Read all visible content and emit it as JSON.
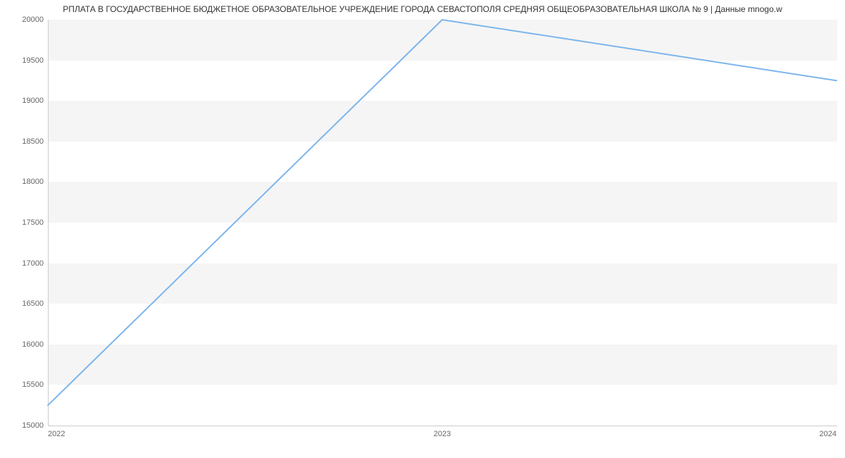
{
  "chart_data": {
    "type": "line",
    "title": "РПЛАТА В ГОСУДАРСТВЕННОЕ БЮДЖЕТНОЕ ОБРАЗОВАТЕЛЬНОЕ УЧРЕЖДЕНИЕ ГОРОДА СЕВАСТОПОЛЯ СРЕДНЯЯ ОБЩЕОБРАЗОВАТЕЛЬНАЯ ШКОЛА № 9 | Данные mnogo.w",
    "x": [
      2022,
      2023,
      2024
    ],
    "values": [
      15250,
      20000,
      19250
    ],
    "xlabel": "",
    "ylabel": "",
    "ylim": [
      15000,
      20000
    ],
    "y_ticks": [
      15000,
      15500,
      16000,
      16500,
      17000,
      17500,
      18000,
      18500,
      19000,
      19500,
      20000
    ],
    "x_ticks": [
      2022,
      2023,
      2024
    ],
    "line_color": "#7cb5ec"
  }
}
